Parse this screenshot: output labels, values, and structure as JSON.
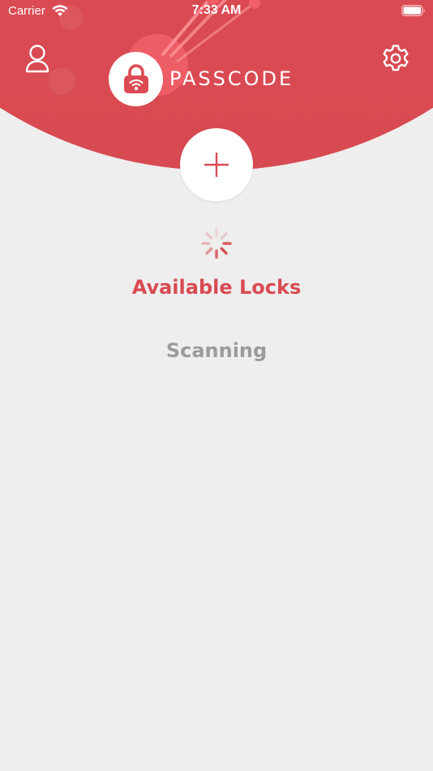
{
  "status_bar": {
    "carrier": "Carrier",
    "time": "7:33 AM",
    "wifi_icon": "wifi-icon",
    "battery_icon": "battery-icon"
  },
  "header": {
    "user_icon": "user-icon",
    "settings_icon": "gear-icon",
    "logo_icon": "padlock-wifi-icon",
    "logo_text": "PASSCODE"
  },
  "main": {
    "add_icon": "plus-icon",
    "spinner_icon": "loading-spinner-icon",
    "section_title": "Available Locks",
    "status_text": "Scanning"
  },
  "colors": {
    "brand": "#dc4a53",
    "background": "#eeeeee",
    "title": "#d84b52",
    "muted": "#9b9b9b"
  }
}
